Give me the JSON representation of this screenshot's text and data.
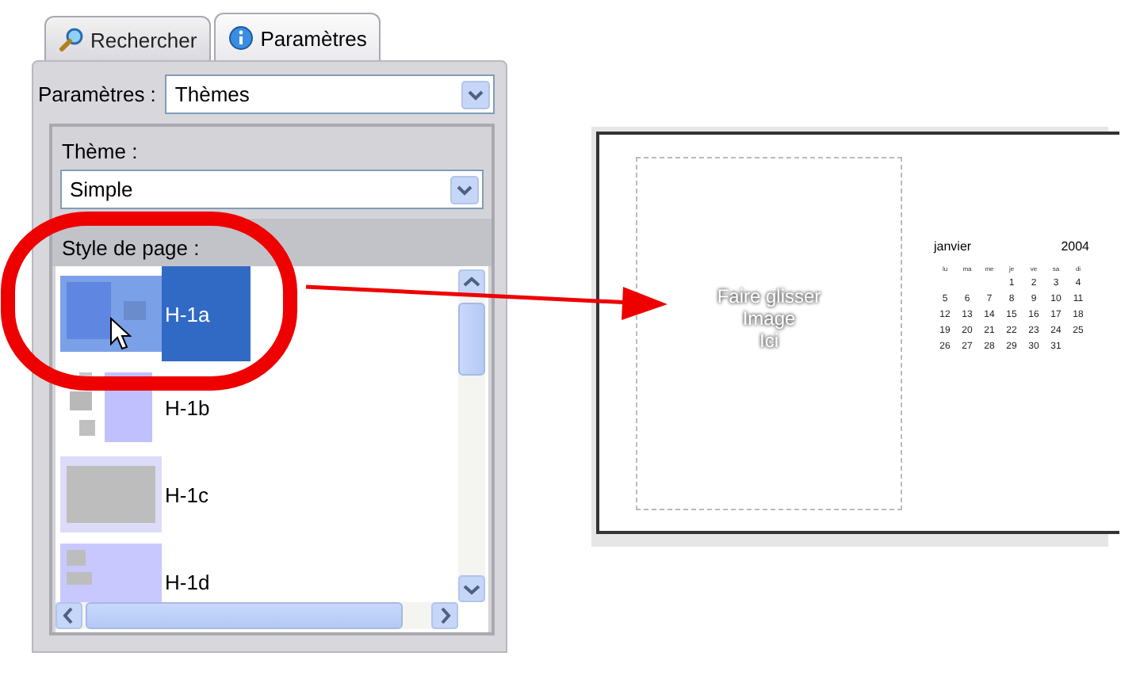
{
  "tabs": [
    {
      "label": "Rechercher",
      "selected": false
    },
    {
      "label": "Paramètres",
      "selected": true
    }
  ],
  "settings": {
    "label": "Paramètres :",
    "value": "Thèmes"
  },
  "theme": {
    "label": "Thème :",
    "value": "Simple"
  },
  "page_style": {
    "label": "Style de page :",
    "items": [
      {
        "label": "H-1a",
        "kind": "split",
        "selected": true
      },
      {
        "label": "H-1b",
        "kind": "blocks",
        "selected": false
      },
      {
        "label": "H-1c",
        "kind": "full",
        "selected": false
      },
      {
        "label": "H-1d",
        "kind": "mixed",
        "selected": false
      }
    ]
  },
  "preview": {
    "drop_text": "Faire glisser\nImage\nIci",
    "calendar": {
      "month": "janvier",
      "year": "2004",
      "weekdays": [
        "lu",
        "ma",
        "me",
        "je",
        "ve",
        "sa",
        "di"
      ],
      "weeks": [
        [
          "1",
          "2",
          "3",
          "4"
        ],
        [
          "5",
          "6",
          "7",
          "8",
          "9",
          "10",
          "11"
        ],
        [
          "12",
          "13",
          "14",
          "15",
          "16",
          "17",
          "18"
        ],
        [
          "19",
          "20",
          "21",
          "22",
          "23",
          "24",
          "25"
        ],
        [
          "26",
          "27",
          "28",
          "29",
          "30",
          "31"
        ]
      ]
    }
  }
}
